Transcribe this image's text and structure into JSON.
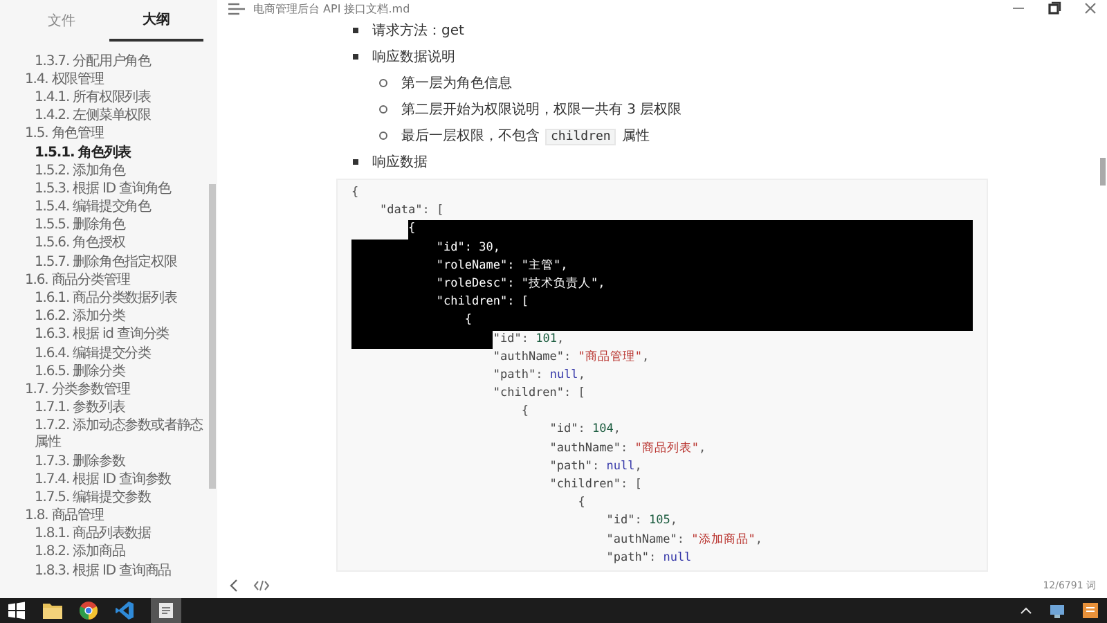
{
  "sidebar": {
    "tabs": [
      {
        "label": "文件",
        "selected": false
      },
      {
        "label": "大纲",
        "selected": true
      }
    ],
    "outline": [
      {
        "children": [
          {
            "label": "1.3.7. 分配用户角色",
            "selected": false
          }
        ]
      },
      {
        "label": "1.4. 权限管理",
        "selected": false,
        "children": [
          {
            "label": "1.4.1. 所有权限列表",
            "selected": false
          },
          {
            "label": "1.4.2. 左侧菜单权限",
            "selected": false
          }
        ]
      },
      {
        "label": "1.5. 角色管理",
        "selected": false,
        "children": [
          {
            "label": "1.5.1. 角色列表",
            "selected": true
          },
          {
            "label": "1.5.2. 添加角色",
            "selected": false
          },
          {
            "label": "1.5.3. 根据 ID 查询角色",
            "selected": false
          },
          {
            "label": "1.5.4. 编辑提交角色",
            "selected": false
          },
          {
            "label": "1.5.5. 删除角色",
            "selected": false
          },
          {
            "label": "1.5.6. 角色授权",
            "selected": false
          },
          {
            "label": "1.5.7. 删除角色指定权限",
            "selected": false
          }
        ]
      },
      {
        "label": "1.6. 商品分类管理",
        "selected": false,
        "children": [
          {
            "label": "1.6.1. 商品分类数据列表",
            "selected": false
          },
          {
            "label": "1.6.2. 添加分类",
            "selected": false
          },
          {
            "label": "1.6.3. 根据 id 查询分类",
            "selected": false
          },
          {
            "label": "1.6.4. 编辑提交分类",
            "selected": false
          },
          {
            "label": "1.6.5. 删除分类",
            "selected": false
          }
        ]
      },
      {
        "label": "1.7. 分类参数管理",
        "selected": false,
        "children": [
          {
            "label": "1.7.1. 参数列表",
            "selected": false
          },
          {
            "label": "1.7.2. 添加动态参数或者静态属性",
            "selected": false
          },
          {
            "label": "1.7.3. 删除参数",
            "selected": false
          },
          {
            "label": "1.7.4. 根据 ID 查询参数",
            "selected": false
          },
          {
            "label": "1.7.5. 编辑提交参数",
            "selected": false
          }
        ]
      },
      {
        "label": "1.8. 商品管理",
        "selected": false,
        "children": [
          {
            "label": "1.8.1. 商品列表数据",
            "selected": false
          },
          {
            "label": "1.8.2. 添加商品",
            "selected": false
          },
          {
            "label": "1.8.3. 根据 ID 查询商品",
            "selected": false
          }
        ]
      }
    ]
  },
  "window": {
    "title": "电商管理后台 API 接口文档.md"
  },
  "document": {
    "list": [
      {
        "text": "请求方法：get"
      },
      {
        "text": "响应数据说明",
        "children": [
          {
            "parts": [
              {
                "t": "第一层为角色信息",
                "kind": "text"
              }
            ]
          },
          {
            "parts": [
              {
                "t": "第二层开始为权限说明，权限一共有 3 层权限",
                "kind": "text"
              }
            ]
          },
          {
            "parts": [
              {
                "t": "最后一层权限，不包含",
                "kind": "text"
              },
              {
                "t": "children",
                "kind": "code"
              },
              {
                "t": "属性",
                "kind": "text"
              }
            ]
          }
        ]
      },
      {
        "text": "响应数据"
      }
    ],
    "code": [
      {
        "kind": "plain",
        "tokens": [
          {
            "t": "{",
            "kind": "punct"
          }
        ]
      },
      {
        "kind": "plain",
        "tokens": [
          {
            "t": "\"data\"",
            "kind": "key"
          },
          {
            "t": ": [",
            "kind": "punct"
          }
        ]
      },
      {
        "kind": "tail",
        "tokens": [
          {
            "t": "{",
            "kind": "punct"
          }
        ]
      },
      {
        "kind": "full",
        "tokens": [
          {
            "t": "\"id\"",
            "kind": "key"
          },
          {
            "t": ": ",
            "kind": "punct"
          },
          {
            "t": "30",
            "kind": "number"
          },
          {
            "t": ",",
            "kind": "punct"
          }
        ]
      },
      {
        "kind": "full",
        "tokens": [
          {
            "t": "\"roleName\"",
            "kind": "key"
          },
          {
            "t": ": ",
            "kind": "punct"
          },
          {
            "t": "\"主管\"",
            "kind": "string"
          },
          {
            "t": ",",
            "kind": "punct"
          }
        ]
      },
      {
        "kind": "full",
        "tokens": [
          {
            "t": "\"roleDesc\"",
            "kind": "key"
          },
          {
            "t": ": ",
            "kind": "punct"
          },
          {
            "t": "\"技术负责人\"",
            "kind": "string"
          },
          {
            "t": ",",
            "kind": "punct"
          }
        ]
      },
      {
        "kind": "full",
        "tokens": [
          {
            "t": "\"children\"",
            "kind": "key"
          },
          {
            "t": ": [",
            "kind": "punct"
          }
        ]
      },
      {
        "kind": "full",
        "tokens": [
          {
            "t": "{",
            "kind": "punct"
          }
        ]
      },
      {
        "kind": "head",
        "tokens": [
          {
            "t": "\"id\"",
            "kind": "key"
          },
          {
            "t": ": ",
            "kind": "punct"
          },
          {
            "t": "101",
            "kind": "number"
          },
          {
            "t": ",",
            "kind": "punct"
          }
        ]
      },
      {
        "kind": "plain",
        "tokens": [
          {
            "t": "\"authName\"",
            "kind": "key"
          },
          {
            "t": ": ",
            "kind": "punct"
          },
          {
            "t": "\"商品管理\"",
            "kind": "string"
          },
          {
            "t": ",",
            "kind": "punct"
          }
        ]
      },
      {
        "kind": "plain",
        "tokens": [
          {
            "t": "\"path\"",
            "kind": "key"
          },
          {
            "t": ": ",
            "kind": "punct"
          },
          {
            "t": "null",
            "kind": "null"
          },
          {
            "t": ",",
            "kind": "punct"
          }
        ]
      },
      {
        "kind": "plain",
        "tokens": [
          {
            "t": "\"children\"",
            "kind": "key"
          },
          {
            "t": ": [",
            "kind": "punct"
          }
        ]
      },
      {
        "kind": "plain",
        "tokens": [
          {
            "t": "{",
            "kind": "punct"
          }
        ]
      },
      {
        "kind": "plain",
        "tokens": [
          {
            "t": "\"id\"",
            "kind": "key"
          },
          {
            "t": ": ",
            "kind": "punct"
          },
          {
            "t": "104",
            "kind": "number"
          },
          {
            "t": ",",
            "kind": "punct"
          }
        ]
      },
      {
        "kind": "plain",
        "tokens": [
          {
            "t": "\"authName\"",
            "kind": "key"
          },
          {
            "t": ": ",
            "kind": "punct"
          },
          {
            "t": "\"商品列表\"",
            "kind": "string"
          },
          {
            "t": ",",
            "kind": "punct"
          }
        ]
      },
      {
        "kind": "plain",
        "tokens": [
          {
            "t": "\"path\"",
            "kind": "key"
          },
          {
            "t": ": ",
            "kind": "punct"
          },
          {
            "t": "null",
            "kind": "null"
          },
          {
            "t": ",",
            "kind": "punct"
          }
        ]
      },
      {
        "kind": "plain",
        "tokens": [
          {
            "t": "\"children\"",
            "kind": "key"
          },
          {
            "t": ": [",
            "kind": "punct"
          }
        ]
      },
      {
        "kind": "plain",
        "tokens": [
          {
            "t": "{",
            "kind": "punct"
          }
        ]
      },
      {
        "kind": "plain",
        "tokens": [
          {
            "t": "\"id\"",
            "kind": "key"
          },
          {
            "t": ": ",
            "kind": "punct"
          },
          {
            "t": "105",
            "kind": "number"
          },
          {
            "t": ",",
            "kind": "punct"
          }
        ]
      },
      {
        "kind": "plain",
        "tokens": [
          {
            "t": "\"authName\"",
            "kind": "key"
          },
          {
            "t": ": ",
            "kind": "punct"
          },
          {
            "t": "\"添加商品\"",
            "kind": "string"
          },
          {
            "t": ",",
            "kind": "punct"
          }
        ]
      },
      {
        "kind": "plain",
        "tokens": [
          {
            "t": "\"path\"",
            "kind": "key"
          },
          {
            "t": ": ",
            "kind": "punct"
          },
          {
            "t": "null",
            "kind": "null"
          }
        ]
      }
    ]
  },
  "status_bar": {
    "word_count": "12/6791 词"
  }
}
